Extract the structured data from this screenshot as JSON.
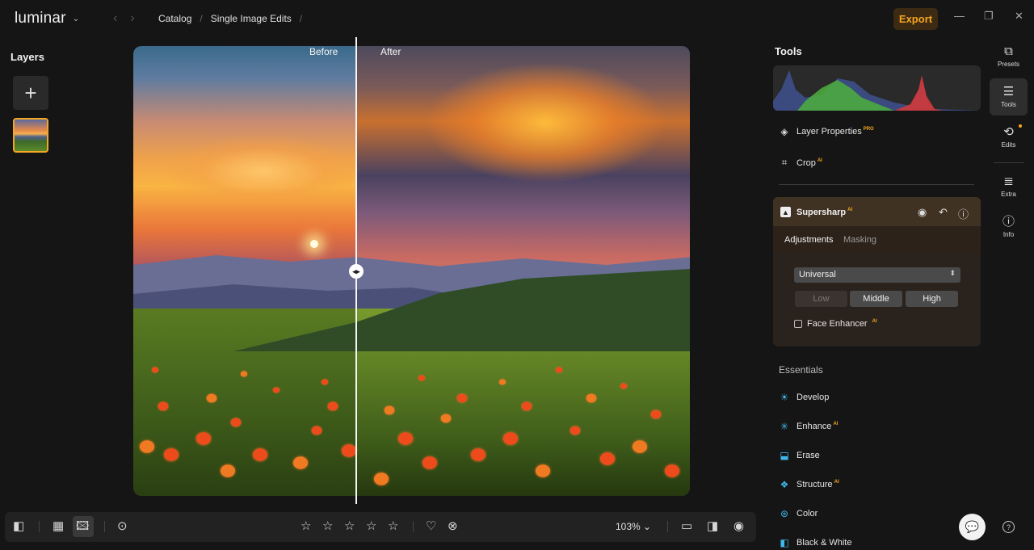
{
  "app": {
    "name": "luminar"
  },
  "breadcrumb": {
    "items": [
      "Catalog",
      "Single Image Edits"
    ]
  },
  "header": {
    "export_label": "Export"
  },
  "layers": {
    "title": "Layers"
  },
  "viewer": {
    "before_label": "Before",
    "after_label": "After"
  },
  "toolbar": {
    "zoom": "103%",
    "rating_stars": 5
  },
  "tools": {
    "title": "Tools",
    "layer_properties": {
      "label": "Layer Properties",
      "badge": "PRO"
    },
    "crop": {
      "label": "Crop",
      "badge": "AI"
    },
    "supersharp": {
      "title": "Supersharp",
      "badge": "AI",
      "tabs": [
        "Adjustments",
        "Masking"
      ],
      "mode": "Universal",
      "levels": [
        "Low",
        "Middle",
        "High"
      ],
      "face_enhancer": {
        "label": "Face Enhancer",
        "badge": "AI",
        "checked": false
      }
    },
    "essentials_title": "Essentials",
    "essentials": [
      {
        "label": "Develop",
        "badge": "",
        "icon": "sun-icon"
      },
      {
        "label": "Enhance",
        "badge": "AI",
        "icon": "sparkle-icon"
      },
      {
        "label": "Erase",
        "badge": "",
        "icon": "eraser-icon"
      },
      {
        "label": "Structure",
        "badge": "AI",
        "icon": "structure-icon"
      },
      {
        "label": "Color",
        "badge": "",
        "icon": "color-icon"
      },
      {
        "label": "Black & White",
        "badge": "",
        "icon": "bw-icon"
      }
    ]
  },
  "rail": [
    {
      "label": "Presets",
      "icon": "presets-icon"
    },
    {
      "label": "Tools",
      "icon": "sliders-icon"
    },
    {
      "label": "Edits",
      "icon": "history-icon"
    },
    {
      "label": "Extra",
      "icon": "list-icon"
    },
    {
      "label": "Info",
      "icon": "info-icon"
    }
  ],
  "colors": {
    "accent": "#f5a623",
    "panel": "#2a2a2a",
    "background": "#151515"
  }
}
